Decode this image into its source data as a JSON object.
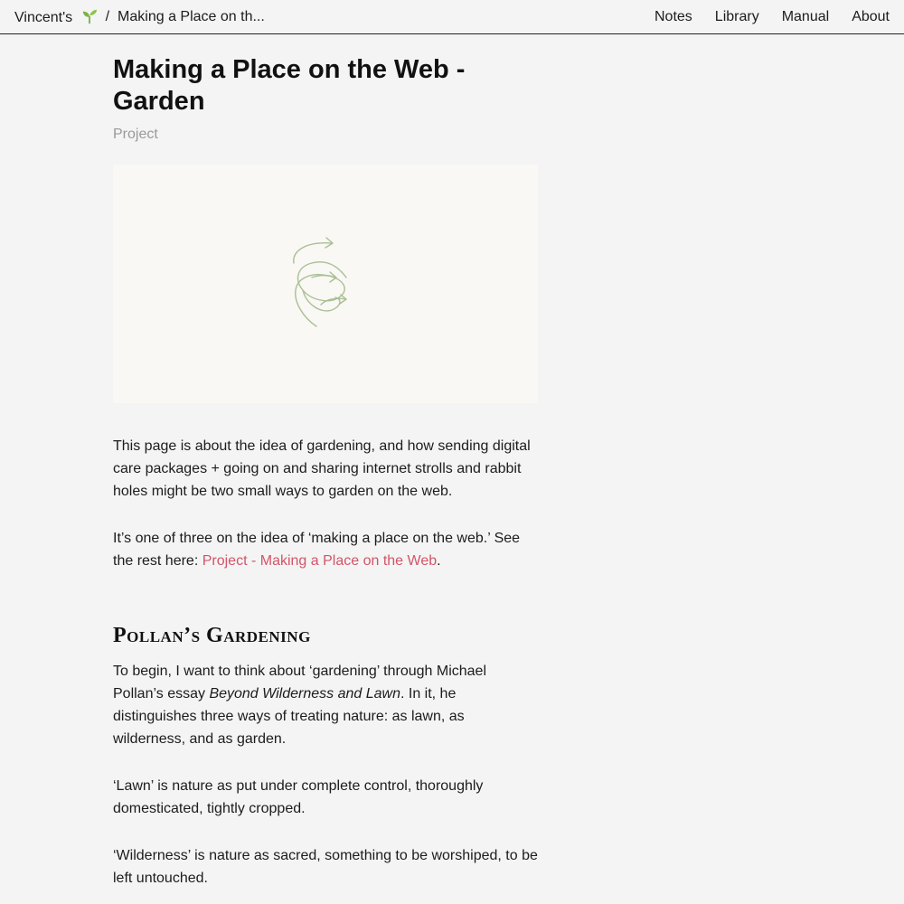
{
  "topbar": {
    "site_name": "Vincent's",
    "site_icon": "seedling-icon",
    "separator": "/",
    "current_page": "Making a Place on th...",
    "nav": [
      {
        "label": "Notes"
      },
      {
        "label": "Library"
      },
      {
        "label": "Manual"
      },
      {
        "label": "About"
      }
    ]
  },
  "page": {
    "title": "Making a Place on the Web - Garden",
    "subtitle": "Project",
    "hero_icon": "spiral-arrow-icon"
  },
  "body": {
    "p1": "This page is about the idea of gardening, and how sending digital care packages + going on and sharing internet strolls and rabbit holes might be two small ways to garden on the web.",
    "p2_before": "It’s one of three on the idea of ‘making a place on the web.’ See the rest here: ",
    "p2_link": "Project - Making a Place on the Web",
    "p2_after": ".",
    "section_heading": "Pollan’s Gardening",
    "p3_before": "To begin, I want to think about ‘gardening’ through Michael Pollan’s essay ",
    "p3_em": "Beyond Wilderness and Lawn",
    "p3_after": ". In it, he distinguishes three ways of treating nature: as lawn, as wilderness, and as garden.",
    "p4": "‘Lawn’ is nature as put under complete control, thoroughly domesticated, tightly cropped.",
    "p5": "‘Wilderness’ is nature as sacred, something to be worshiped, to be left untouched."
  },
  "colors": {
    "background": "#f4f4f4",
    "link": "#d35469",
    "muted": "#9a9a9a",
    "hero_bg": "#f9f8f4",
    "hero_stroke": "#a9bf95",
    "seedling": "#6fa33c"
  }
}
